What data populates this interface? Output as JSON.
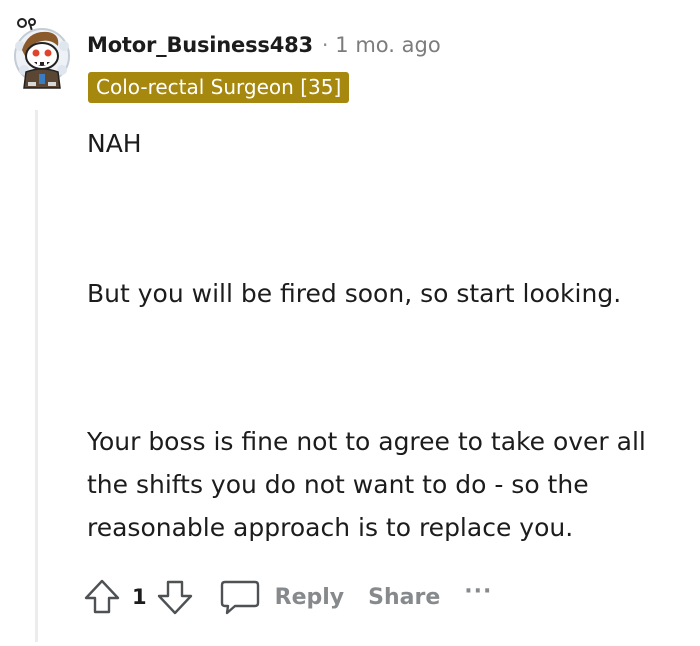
{
  "comment": {
    "author": "Motor_Business483",
    "separator": "·",
    "timestamp": "1 mo. ago",
    "flair": "Colo-rectal Surgeon [35]",
    "flair_color": "#a7880f",
    "avatar_icon": "snoo-avatar-icon",
    "body": [
      "NAH",
      "But you will be fired soon, so start looking.",
      "Your boss is fine not to agree to take over all the shifts you do not want to do - so the reasonable approach is to replace you."
    ]
  },
  "actions": {
    "upvote_icon": "upvote-arrow-icon",
    "score": "1",
    "downvote_icon": "downvote-arrow-icon",
    "comment_icon": "comment-bubble-icon",
    "reply_label": "Reply",
    "share_label": "Share",
    "more_label": "···"
  }
}
